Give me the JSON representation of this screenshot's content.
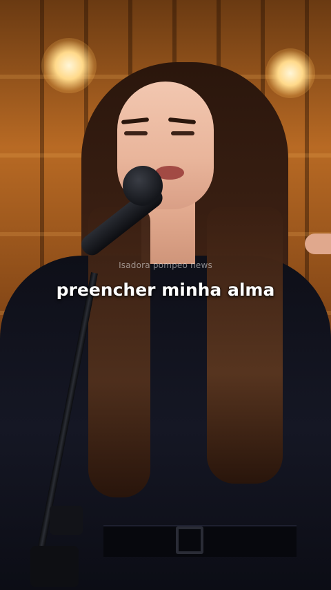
{
  "video": {
    "watermark": "Isadora pompeo news",
    "caption": "preencher minha alma"
  },
  "colors": {
    "background_warm": "#b86a24",
    "caption_text": "#ffffff",
    "watermark_text": "#ebebeb"
  },
  "icons": [
    "microphone-icon"
  ]
}
